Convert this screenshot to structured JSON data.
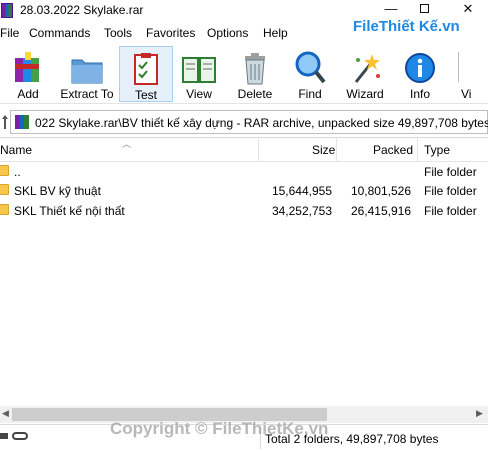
{
  "window": {
    "title": "28.03.2022 Skylake.rar",
    "logo_brand": "File",
    "logo_text": "Thiết Kế",
    "logo_suffix": ".vn",
    "min_glyph": "—",
    "close_glyph": "✕"
  },
  "menu": [
    "File",
    "Commands",
    "Tools",
    "Favorites",
    "Options",
    "Help"
  ],
  "toolbar": {
    "add": "Add",
    "extract": "Extract To",
    "test": "Test",
    "view": "View",
    "delete": "Delete",
    "find": "Find",
    "wizard": "Wizard",
    "info": "Info",
    "virus": "Vi"
  },
  "address": {
    "path": "022 Skylake.rar\\BV thiết kế xây dựng - RAR archive, unpacked size 49,897,708 bytes"
  },
  "columns": {
    "name": "Name",
    "size": "Size",
    "packed": "Packed",
    "type": "Type"
  },
  "files": [
    {
      "name": "..",
      "size": "",
      "packed": "",
      "type": "File folder"
    },
    {
      "name": "SKL BV kỹ thuật",
      "size": "15,644,955",
      "packed": "10,801,526",
      "type": "File folder"
    },
    {
      "name": "SKL Thiết kế nội thất",
      "size": "34,252,753",
      "packed": "26,415,916",
      "type": "File folder"
    }
  ],
  "status": {
    "summary": "Total 2 folders, 49,897,708 bytes",
    "watermark": "Copyright © FileThietKe.vn"
  }
}
